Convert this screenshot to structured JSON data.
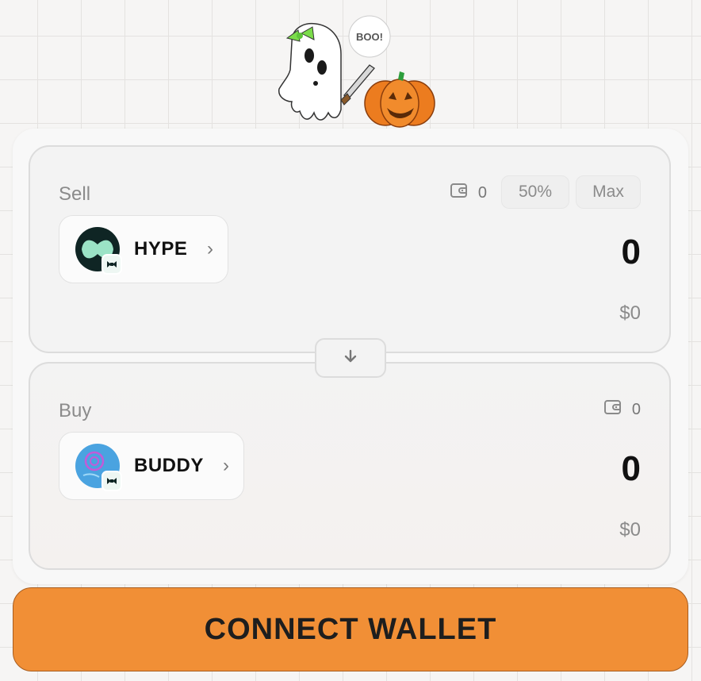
{
  "mascot": {
    "speech_bubble": "BOO!"
  },
  "sell": {
    "label": "Sell",
    "balance": "0",
    "half_label": "50%",
    "max_label": "Max",
    "token": {
      "symbol": "HYPE",
      "icon": "hype-logo",
      "color": "#0f2524"
    },
    "amount": "0",
    "usd_value": "$0"
  },
  "swap": {
    "icon": "arrow-down-icon"
  },
  "buy": {
    "label": "Buy",
    "balance": "0",
    "token": {
      "symbol": "BUDDY",
      "icon": "buddy-logo",
      "color": "#4aa3e0"
    },
    "amount": "0",
    "usd_value": "$0"
  },
  "connect_button": {
    "label": "CONNECT WALLET",
    "color": "#f18f36"
  }
}
